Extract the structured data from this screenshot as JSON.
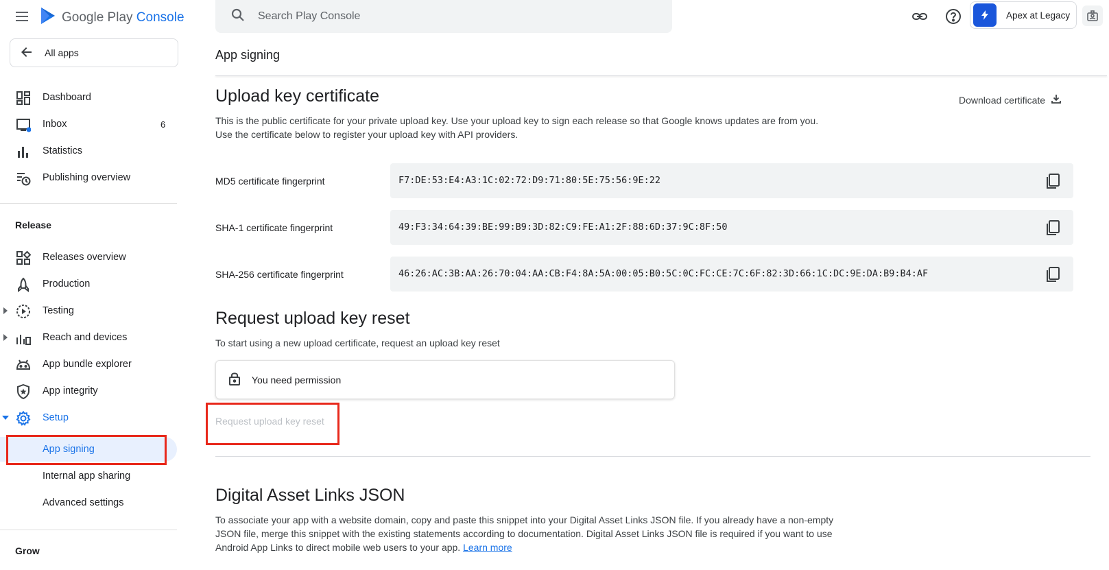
{
  "brand": {
    "name_part1": "Google Play",
    "name_part2": "Console"
  },
  "sidebar": {
    "all_apps_label": "All apps",
    "top_items": [
      {
        "label": "Dashboard"
      },
      {
        "label": "Inbox",
        "count": "6"
      },
      {
        "label": "Statistics"
      },
      {
        "label": "Publishing overview"
      }
    ],
    "release_section": {
      "title": "Release",
      "items": [
        {
          "label": "Releases overview"
        },
        {
          "label": "Production"
        },
        {
          "label": "Testing"
        },
        {
          "label": "Reach and devices"
        },
        {
          "label": "App bundle explorer"
        },
        {
          "label": "App integrity"
        },
        {
          "label": "Setup"
        },
        {
          "label": "App signing"
        },
        {
          "label": "Internal app sharing"
        },
        {
          "label": "Advanced settings"
        }
      ]
    },
    "grow_section": {
      "title": "Grow"
    }
  },
  "topbar": {
    "search_placeholder": "Search Play Console",
    "account_name": "Apex at Legacy"
  },
  "main": {
    "page_title": "App signing",
    "upload_cert": {
      "heading": "Upload key certificate",
      "description": "This is the public certificate for your private upload key. Use your upload key to sign each release so that Google knows updates are from you. Use the certificate below to register your upload key with API providers.",
      "download_label": "Download certificate",
      "fingerprints": [
        {
          "label": "MD5 certificate fingerprint",
          "value": "F7:DE:53:E4:A3:1C:02:72:D9:71:80:5E:75:56:9E:22"
        },
        {
          "label": "SHA-1 certificate fingerprint",
          "value": "49:F3:34:64:39:BE:99:B9:3D:82:C9:FE:A1:2F:88:6D:37:9C:8F:50"
        },
        {
          "label": "SHA-256 certificate fingerprint",
          "value": "46:26:AC:3B:AA:26:70:04:AA:CB:F4:8A:5A:00:05:B0:5C:0C:FC:CE:7C:6F:82:3D:66:1C:DC:9E:DA:B9:B4:AF"
        }
      ]
    },
    "reset": {
      "heading": "Request upload key reset",
      "description": "To start using a new upload certificate, request an upload key reset",
      "permission_text": "You need permission",
      "button_label": "Request upload key reset"
    },
    "asset_links": {
      "heading": "Digital Asset Links JSON",
      "description": "To associate your app with a website domain, copy and paste this snippet into your Digital Asset Links JSON file. If you already have a non-empty JSON file, merge this snippet with the existing statements according to documentation. Digital Asset Links JSON file is required if you want to use Android App Links to direct mobile web users to your app.",
      "learn_more": "Learn more"
    }
  },
  "colors": {
    "accent": "#1a73e8",
    "highlight": "#e8281b",
    "selected_bg": "#e8f0fe"
  }
}
